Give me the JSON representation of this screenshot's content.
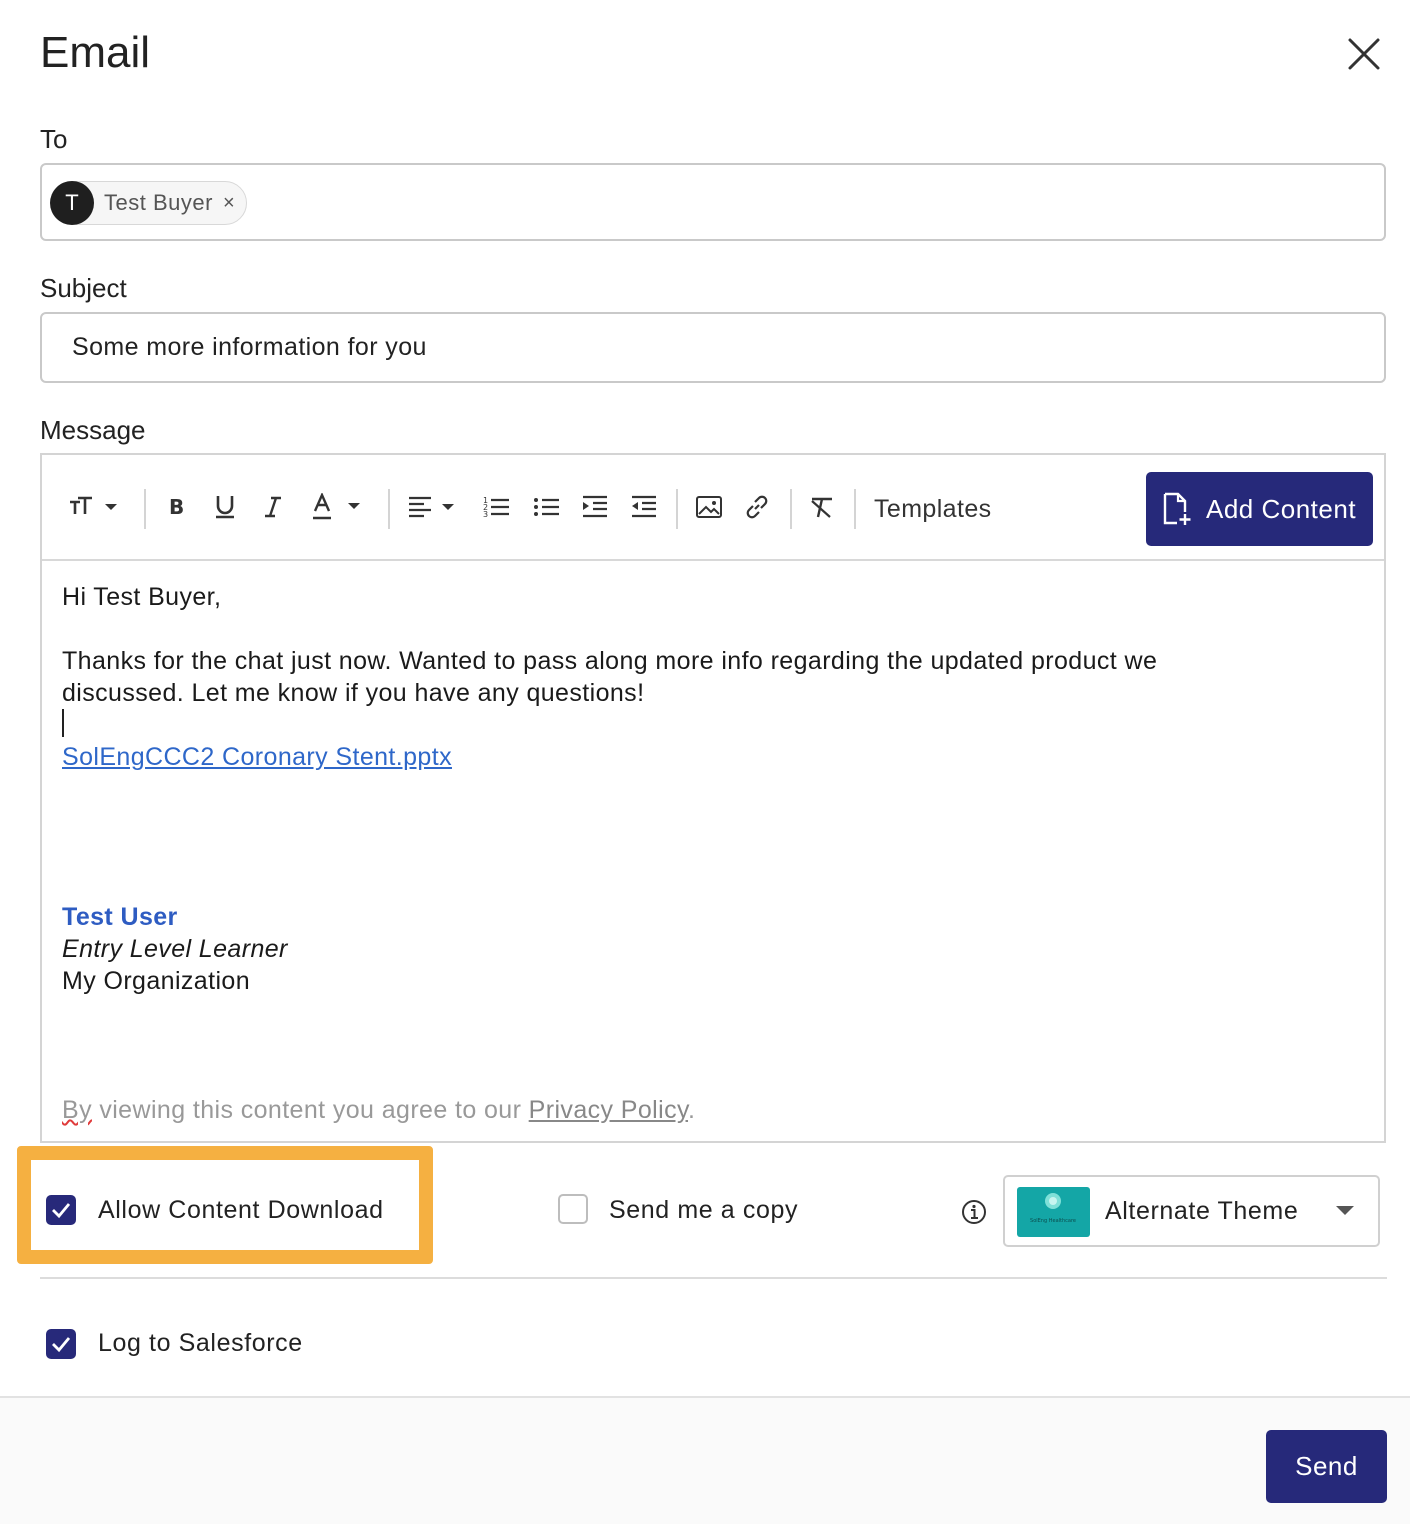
{
  "dialog": {
    "title": "Email"
  },
  "to": {
    "label": "To",
    "recipients": [
      {
        "initial": "T",
        "name": "Test Buyer",
        "remove": "×"
      }
    ]
  },
  "subject": {
    "label": "Subject",
    "value": "Some more information for you"
  },
  "message": {
    "label": "Message",
    "toolbar": {
      "templates_label": "Templates",
      "add_content_label": "Add Content"
    },
    "greeting": "Hi Test Buyer,",
    "paragraph_line1": "Thanks for the chat just now. Wanted to pass along more info regarding the updated product we",
    "paragraph_line2": "discussed. Let me know if you have any questions!",
    "attachment_link": "SolEngCCC2 Coronary Stent.pptx",
    "signature": {
      "name": "Test User",
      "title": "Entry Level Learner",
      "organization": "My Organization"
    },
    "privacy": {
      "prefix_misspelled": "By",
      "text": " viewing this content you agree to our ",
      "link": "Privacy Policy",
      "suffix": "."
    }
  },
  "options": {
    "allow_download": {
      "label": "Allow Content Download",
      "checked": true
    },
    "send_copy": {
      "label": "Send me a copy",
      "checked": false
    },
    "theme": {
      "selected": "Alternate Theme",
      "thumb_text": "SolEng Healthcare"
    },
    "log_salesforce": {
      "label": "Log to Salesforce",
      "checked": true
    }
  },
  "footer": {
    "send_label": "Send"
  },
  "colors": {
    "primary": "#26297a",
    "highlight": "#f5b041",
    "link": "#2e67c9",
    "theme_thumb": "#14a6a6"
  }
}
